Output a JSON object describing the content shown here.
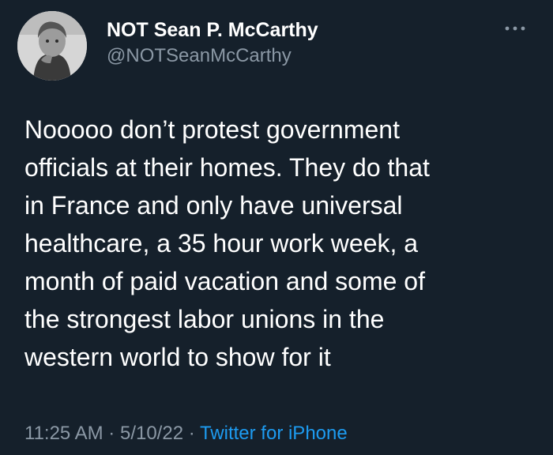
{
  "author": {
    "name": "NOT Sean P. McCarthy",
    "handle": "@NOTSeanMcCarthy",
    "avatar_icon": "profile-photo-icon"
  },
  "menu": {
    "more_icon": "more-horizontal-icon"
  },
  "tweet": {
    "text": "Nooooo don’t protest government\nofficials at their homes. They do that\nin France and only have universal\nhealthcare, a 35 hour work week, a\nmonth of paid vacation and some of\nthe strongest labor unions in the\nwestern world to show for it",
    "time": "11:25 AM",
    "date": "5/10/22",
    "separator": "·",
    "source": "Twitter for iPhone"
  },
  "colors": {
    "background": "#15202b",
    "text": "#ffffff",
    "secondary_text": "#8b98a5",
    "link": "#1d9bf0"
  }
}
